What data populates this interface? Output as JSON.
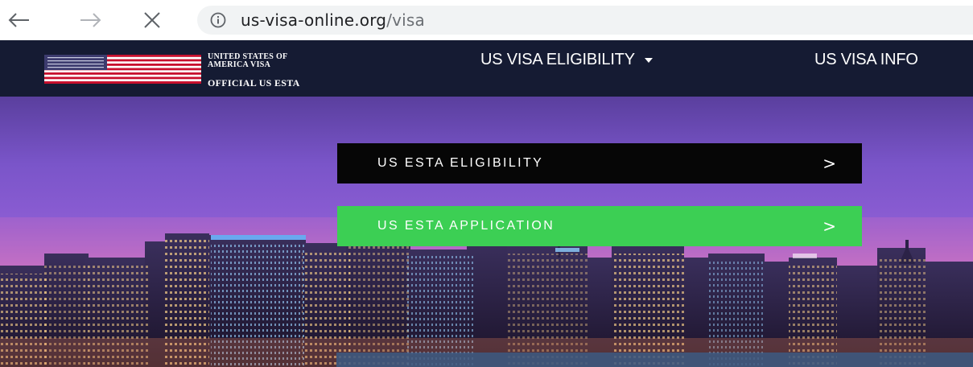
{
  "browser": {
    "url_host": "us-visa-online.org",
    "url_path": "/visa",
    "icons": {
      "back": "back-arrow-icon",
      "forward": "forward-arrow-icon",
      "stop": "close-icon",
      "info": "info-icon"
    }
  },
  "header": {
    "brand_line1": "UNITED STATES OF",
    "brand_line2": "AMERICA VISA",
    "brand_line3": "OFFICIAL US ESTA",
    "menu": [
      {
        "label": "US VISA ELIGIBILITY",
        "has_dropdown": true
      },
      {
        "label": "US VISA INFO"
      }
    ],
    "colors": {
      "background": "#151b33",
      "text": "#ffffff"
    }
  },
  "hero": {
    "cta_eligibility": {
      "label": "US ESTA ELIGIBILITY",
      "arrow": ">",
      "color": "#060606"
    },
    "cta_application": {
      "label": "US ESTA APPLICATION",
      "arrow": ">",
      "color": "#3ccf54"
    }
  }
}
